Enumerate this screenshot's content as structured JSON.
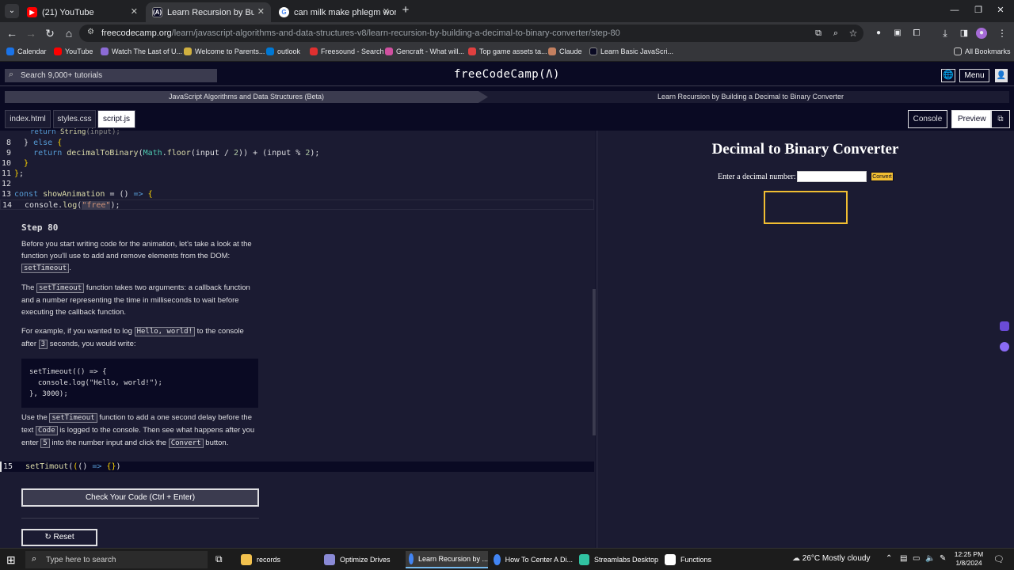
{
  "browser": {
    "tabs": [
      {
        "label": "(21) YouTube"
      },
      {
        "label": "Learn Recursion by Building a D"
      },
      {
        "label": "can milk make phlegm worse -"
      }
    ],
    "url_host": "freecodecamp.org",
    "url_path": "/learn/javascript-algorithms-and-data-structures-v8/learn-recursion-by-building-a-decimal-to-binary-converter/step-80",
    "bookmarks": [
      "Calendar",
      "YouTube",
      "Watch The Last of U...",
      "Welcome to Parents...",
      "outlook",
      "Freesound - Search",
      "Gencraft - What will...",
      "Top game assets ta...",
      "Claude",
      "Learn Basic JavaScri..."
    ],
    "all_bookmarks": "All Bookmarks"
  },
  "fcc": {
    "search_placeholder": "Search 9,000+ tutorials",
    "logo": "freeCodeCamp(Ʌ)",
    "menu": "Menu",
    "breadcrumb_course": "JavaScript Algorithms and Data Structures (Beta)",
    "breadcrumb_project": "Learn Recursion by Building a Decimal to Binary Converter"
  },
  "file_tabs": [
    "index.html",
    "styles.css",
    "script.js"
  ],
  "right_buttons": {
    "console": "Console",
    "preview": "Preview"
  },
  "editor": {
    "line_numbers": [
      "8",
      "9",
      "10",
      "11",
      "12",
      "13",
      "14",
      "15"
    ],
    "step_title": "Step 80",
    "p1_a": "Before you start writing code for the animation, let's take a look at the function you'll use to add and remove elements from the DOM:",
    "p1_code": "setTimeout",
    "p2_a": "The",
    "p2_code": "setTimeout",
    "p2_b": "function takes two arguments: a callback function and a number representing the time in milliseconds to wait before executing the callback function.",
    "p3_a": "For example, if you wanted to log",
    "p3_code1": "Hello, world!",
    "p3_b": "to the console after",
    "p3_code2": "3",
    "p3_c": "seconds, you would write:",
    "example_code": "setTimeout(() => {\n  console.log(\"Hello, world!\");\n}, 3000);",
    "p4_a": "Use the",
    "p4_code1": "setTimeout",
    "p4_b": "function to add a one second delay before the text",
    "p4_code2": "Code",
    "p4_c": "is logged to the console. Then see what happens after you enter",
    "p4_code3": "5",
    "p4_d": "into the number input and click the",
    "p4_code4": "Convert",
    "p4_e": "button.",
    "check_button": "Check Your Code (Ctrl + Enter)",
    "reset_button": "↻ Reset"
  },
  "preview": {
    "title": "Decimal to Binary Converter",
    "label": "Enter a decimal number:",
    "convert": "Convert"
  },
  "taskbar": {
    "search_placeholder": "Type here to search",
    "items": [
      "records",
      "Optimize Drives",
      "Learn Recursion by ...",
      "How To Center A Di...",
      "Streamlabs Desktop",
      "Functions"
    ],
    "weather": "26°C  Mostly cloudy",
    "time": "12:25 PM",
    "date": "1/8/2024"
  }
}
